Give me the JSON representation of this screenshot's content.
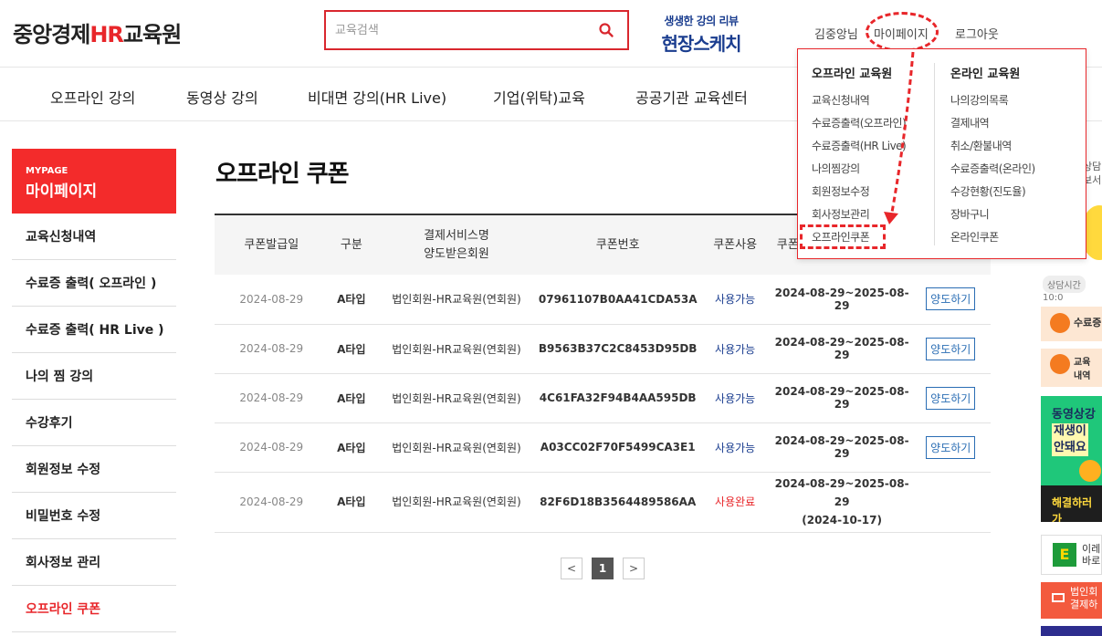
{
  "header": {
    "logo": {
      "prefix": "중앙경제",
      "hr": "HR",
      "suffix": "교육원"
    },
    "search_placeholder": "교육검색",
    "promo": {
      "sub": "생생한 강의 리뷰",
      "main": "현장스케치"
    },
    "user_name": "김중앙님",
    "mypage": "마이페이지",
    "logout": "로그아웃"
  },
  "nav": [
    "오프라인 강의",
    "동영상 강의",
    "비대면 강의(HR Live)",
    "기업(위탁)교육",
    "공공기관 교육센터"
  ],
  "sidebar": {
    "head_en": "MYPAGE",
    "head_ko": "마이페이지",
    "items": [
      "교육신청내역",
      "수료증 출력( 오프라인 )",
      "수료증 출력( HR Live )",
      "나의 찜 강의",
      "수강후기",
      "회원정보 수정",
      "비밀번호 수정",
      "회사정보 관리",
      "오프라인 쿠폰"
    ]
  },
  "page_title": "오프라인 쿠폰",
  "table": {
    "headers": [
      "쿠폰발급일",
      "구분",
      "결제서비스명\n양도받은회원",
      "쿠폰번호",
      "쿠폰사용",
      "쿠폰"
    ],
    "rows": [
      {
        "date": "2024-08-29",
        "type": "A타입",
        "service": "법인회원-HR교육원(연회원)",
        "code": "07961107B0AA41CDA53A",
        "status": "사용가능",
        "period": "2024-08-29~2025-08-29",
        "action": "양도하기"
      },
      {
        "date": "2024-08-29",
        "type": "A타입",
        "service": "법인회원-HR교육원(연회원)",
        "code": "B9563B37C2C8453D95DB",
        "status": "사용가능",
        "period": "2024-08-29~2025-08-29",
        "action": "양도하기"
      },
      {
        "date": "2024-08-29",
        "type": "A타입",
        "service": "법인회원-HR교육원(연회원)",
        "code": "4C61FA32F94B4AA595DB",
        "status": "사용가능",
        "period": "2024-08-29~2025-08-29",
        "action": "양도하기"
      },
      {
        "date": "2024-08-29",
        "type": "A타입",
        "service": "법인회원-HR교육원(연회원)",
        "code": "A03CC02F70F5499CA3E1",
        "status": "사용가능",
        "period": "2024-08-29~2025-08-29",
        "action": "양도하기"
      },
      {
        "date": "2024-08-29",
        "type": "A타입",
        "service": "법인회원-HR교육원(연회원)",
        "code": "82F6D18B3564489586AA",
        "status": "사용완료",
        "period": "2024-08-29~2025-08-29",
        "period2": "(2024-10-17)",
        "action": ""
      }
    ]
  },
  "pager": {
    "prev": "<",
    "current": "1",
    "next": ">"
  },
  "dropdown": {
    "offline": {
      "title": "오프라인 교육원",
      "items": [
        "교육신청내역",
        "수료증출력(오프라인)",
        "수료증출력(HR Live)",
        "나의찜강의",
        "회원정보수정",
        "회사정보관리",
        "오프라인쿠폰"
      ]
    },
    "online": {
      "title": "온라인 교육원",
      "items": [
        "나의강의목록",
        "결제내역",
        "취소/환불내역",
        "수료증출력(온라인)",
        "수강현황(진도율)",
        "장바구니",
        "온라인쿠폰"
      ]
    }
  },
  "right_banners": {
    "consult": "상담\n보서",
    "time_pill": "상담시간",
    "time_val": "10:0",
    "box1": "수료증",
    "box2": "교육\n내역",
    "video_line1": "동영상강",
    "video_line2": "재생이",
    "video_line3": "안돼요",
    "video_bottom": "해결하러 가",
    "e_line1": "이레",
    "e_line2": "바로",
    "corp_line1": "법인회",
    "corp_line2": "결제하"
  },
  "colors": {
    "brand_red": "#e8262a",
    "sidebar_red": "#f32b2b",
    "link_blue": "#2a6db4",
    "navy": "#1a3d8f"
  }
}
